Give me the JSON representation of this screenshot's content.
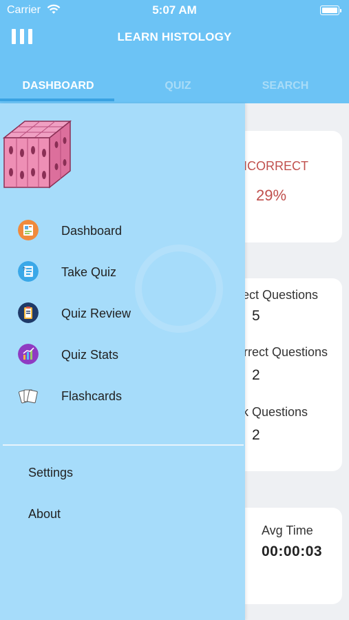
{
  "status_bar": {
    "carrier": "Carrier",
    "time": "5:07 AM"
  },
  "header": {
    "title": "LEARN HISTOLOGY"
  },
  "tabs": [
    {
      "label": "DASHBOARD",
      "active": true
    },
    {
      "label": "QUIZ",
      "active": false
    },
    {
      "label": "SEARCH",
      "active": false
    }
  ],
  "background": {
    "incorrect_label": "ICORRECT",
    "incorrect_value": "29%",
    "q1_label": "ect Questions",
    "q1_value": "5",
    "q2_label": "rrect Questions",
    "q2_value": "2",
    "q3_label": "k Questions",
    "q3_value": "2",
    "avg_label": "Avg Time",
    "avg_value": "00:00:03"
  },
  "drawer": {
    "items": [
      {
        "label": "Dashboard",
        "icon": "dashboard-icon",
        "color": "#f08a3c"
      },
      {
        "label": "Take Quiz",
        "icon": "quiz-icon",
        "color": "#3aa8e8"
      },
      {
        "label": "Quiz Review",
        "icon": "clipboard-icon",
        "color": "#1f3a68"
      },
      {
        "label": "Quiz Stats",
        "icon": "stats-icon",
        "color": "#8f3bc2"
      },
      {
        "label": "Flashcards",
        "icon": "flashcards-icon",
        "color": "#ffffff"
      }
    ],
    "footer": [
      {
        "label": "Settings"
      },
      {
        "label": "About"
      }
    ]
  },
  "colors": {
    "header": "#6cc3f5",
    "drawer": "#a6dcfa",
    "incorrect": "#c0504d"
  }
}
